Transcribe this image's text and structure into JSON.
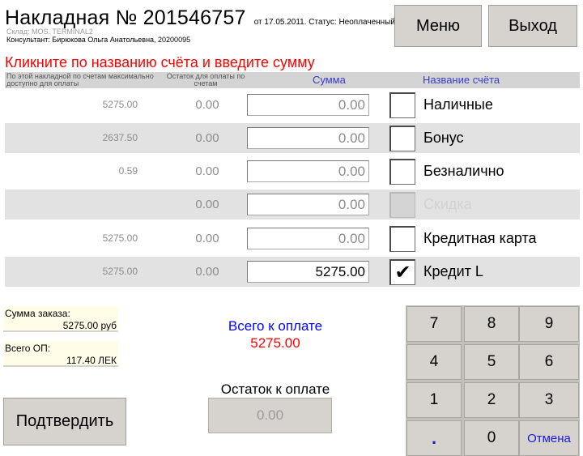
{
  "header": {
    "title": "Накладная № 201546757",
    "meta": "от 17.05.2011. Статус: Неоплаченный.",
    "store": "Склад: MOS. TERMINAL2",
    "consultant": "Консультант: Бирюкова Ольга Анатольевна, 20200095"
  },
  "buttons": {
    "menu": "Меню",
    "exit": "Выход",
    "confirm": "Подтвердить"
  },
  "instruction": "Кликните по названию счёта и введите сумму",
  "table": {
    "headers": {
      "available": "По этой накладной по счетам максимально доступно для оплаты",
      "remaining": "Остаток для оплаты по счетам",
      "amount": "Сумма",
      "account": "Название счёта"
    },
    "rows": [
      {
        "available": "5275.00",
        "remaining": "0.00",
        "amount": "0.00",
        "checked": false,
        "disabled": false,
        "name": "Наличные",
        "check_mark": ""
      },
      {
        "available": "2637.50",
        "remaining": "0.00",
        "amount": "0.00",
        "checked": false,
        "disabled": false,
        "name": "Бонус",
        "check_mark": ""
      },
      {
        "available": "0.59",
        "remaining": "0.00",
        "amount": "0.00",
        "checked": false,
        "disabled": false,
        "name": "Безналично",
        "check_mark": ""
      },
      {
        "available": "",
        "remaining": "0.00",
        "amount": "0.00",
        "checked": false,
        "disabled": true,
        "name": "Скидка",
        "check_mark": ""
      },
      {
        "available": "5275.00",
        "remaining": "0.00",
        "amount": "0.00",
        "checked": false,
        "disabled": false,
        "name": "Кредитная карта",
        "check_mark": ""
      },
      {
        "available": "5275.00",
        "remaining": "0.00",
        "amount": "5275.00",
        "checked": true,
        "disabled": false,
        "name": "Кредит L",
        "check_mark": "✔"
      }
    ]
  },
  "summary": {
    "order_label": "Сумма заказа:",
    "order_value": "5275.00 руб",
    "op_label": "Всего ОП:",
    "op_value": "117.40 ЛЕК",
    "total_label": "Всего к оплате",
    "total_value": "5275.00",
    "remain_label": "Остаток к оплате",
    "remain_value": "0.00"
  },
  "keypad": {
    "k7": "7",
    "k8": "8",
    "k9": "9",
    "k4": "4",
    "k5": "5",
    "k6": "6",
    "k1": "1",
    "k2": "2",
    "k3": "3",
    "dot": ".",
    "k0": "0",
    "cancel": "Отмена"
  },
  "colors": {
    "instruction": "#ff0000",
    "header_blue": "#3a3acc",
    "total_label": "#0000ff",
    "total_value": "#ff0000",
    "button_face": "#d6d3ce"
  }
}
